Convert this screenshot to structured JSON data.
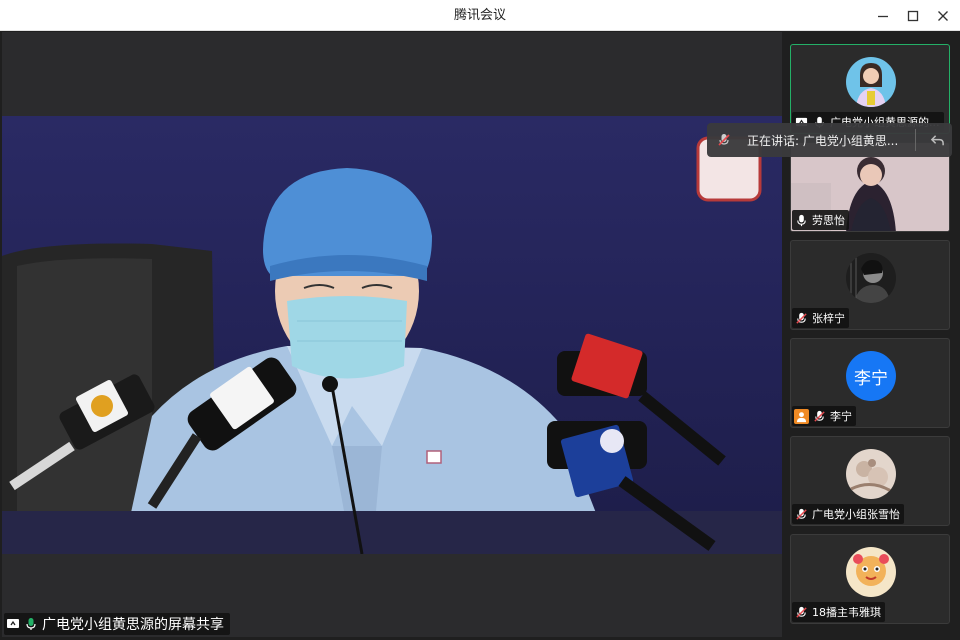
{
  "window": {
    "title": "腾讯会议"
  },
  "share": {
    "label": "广电党小组黄思源的屏幕共享"
  },
  "speaking": {
    "text": "正在讲话: 广电党小组黄思..."
  },
  "participants": [
    {
      "name": "广电党小组黄思源的...",
      "muted": false,
      "sharing": true,
      "avatar": "photo-girl"
    },
    {
      "name": "劳思怡",
      "muted": false,
      "sharing": false,
      "avatar": "video"
    },
    {
      "name": "张梓宁",
      "muted": true,
      "sharing": false,
      "avatar": "photo-dark"
    },
    {
      "name": "李宁",
      "muted": true,
      "sharing": false,
      "avatar_letter": "李宁",
      "avatar_color": "#1677f5"
    },
    {
      "name": "广电党小组张雪怡",
      "muted": true,
      "sharing": false,
      "avatar": "photo-beige"
    },
    {
      "name": "18播主韦雅琪",
      "muted": true,
      "sharing": false,
      "avatar": "photo-toy"
    }
  ],
  "colors": {
    "active_border": "#24b067",
    "avatar_blue": "#1677f5",
    "muted_red": "#e5484d"
  }
}
